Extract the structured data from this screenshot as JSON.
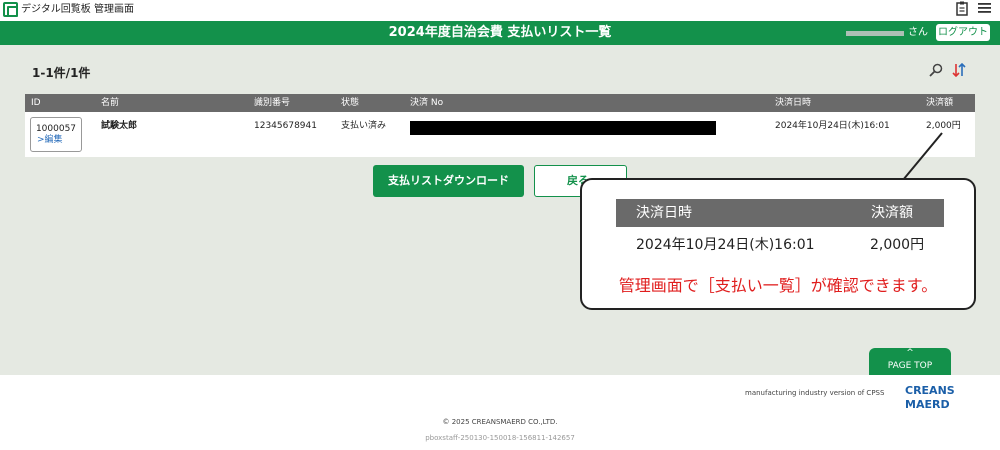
{
  "app": {
    "title": "デジタル回覧板 管理画面",
    "icons": [
      "clipboard-icon",
      "menu-icon"
    ]
  },
  "header": {
    "page_title": "2024年度自治会費 支払いリスト一覧",
    "user_suffix": "さん",
    "logout_label": "ログアウト"
  },
  "list": {
    "count": "1-1件/1件",
    "columns": [
      "ID",
      "名前",
      "識別番号",
      "状態",
      "決済 No",
      "決済日時",
      "決済額"
    ],
    "rows": [
      {
        "id": "1000057",
        "edit_label": ">編集",
        "name": "試験太郎",
        "identifier": "12345678941",
        "status": "支払い済み",
        "datetime": "2024年10月24日(木)16:01",
        "amount": "2,000円"
      }
    ]
  },
  "actions": {
    "download_label": "支払リストダウンロード",
    "back_label": "戻る"
  },
  "callout": {
    "head_datetime": "決済日時",
    "head_amount": "決済額",
    "datetime": "2024年10月24日(木)16:01",
    "amount": "2,000円",
    "note": "管理画面で［支払い一覧］が確認できます。"
  },
  "pagetop": {
    "arrow": "^",
    "label": "PAGE TOP"
  },
  "footer": {
    "brand_text": "manufacturing industry version of CPSS",
    "logo_text": "CREANS MAERD",
    "copyright": "© 2025 CREANSMAERD CO.,LTD.",
    "build": "pboxstaff-250130-150018-156811-142657"
  },
  "colors": {
    "brand_green": "#13914b",
    "table_header": "#6a6a6a",
    "main_bg": "#e5e9e2",
    "note_red": "#e01e1e"
  }
}
